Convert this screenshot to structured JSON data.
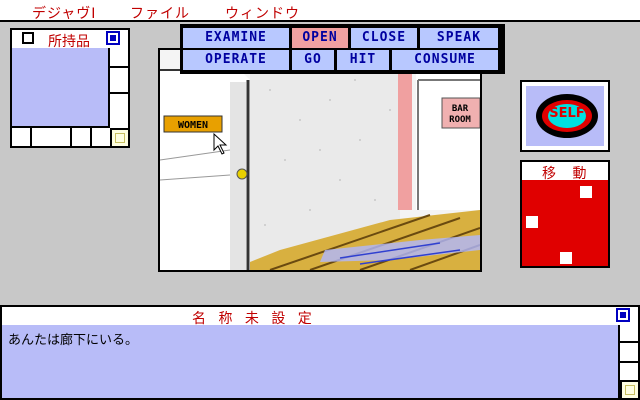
{
  "menu": {
    "items": [
      "デジャヴⅠ",
      "ファイル",
      "ウィンドウ"
    ]
  },
  "inventory_window": {
    "title": "所持品"
  },
  "verbs": {
    "row1": [
      "EXAMINE",
      "OPEN",
      "CLOSE",
      "SPEAK"
    ],
    "row2": [
      "OPERATE",
      "GO",
      "HIT",
      "CONSUME"
    ],
    "active": "OPEN"
  },
  "scene": {
    "door_sign": "WOMEN",
    "bar_sign_line1": "BAR",
    "bar_sign_line2": "ROOM"
  },
  "self_window": {
    "label": "SELF"
  },
  "move_window": {
    "title": "移 動"
  },
  "text_window": {
    "title": "名 称 未 設 定",
    "message": "あんたは廊下にいる。"
  },
  "colors": {
    "menu_text": "#c00000",
    "verb_bg": "#b8c8ff",
    "verb_active_bg": "#f0a0a0",
    "verb_text": "#0000a0",
    "window_fill": "#b8bcf8",
    "move_fill": "#e00000",
    "desktop": "#c8c8c8"
  },
  "icons": {
    "menu": "none",
    "window_close": "close-box-icon",
    "window_zoom": "zoom-box-icon",
    "cursor": "arrow-cursor-icon"
  }
}
